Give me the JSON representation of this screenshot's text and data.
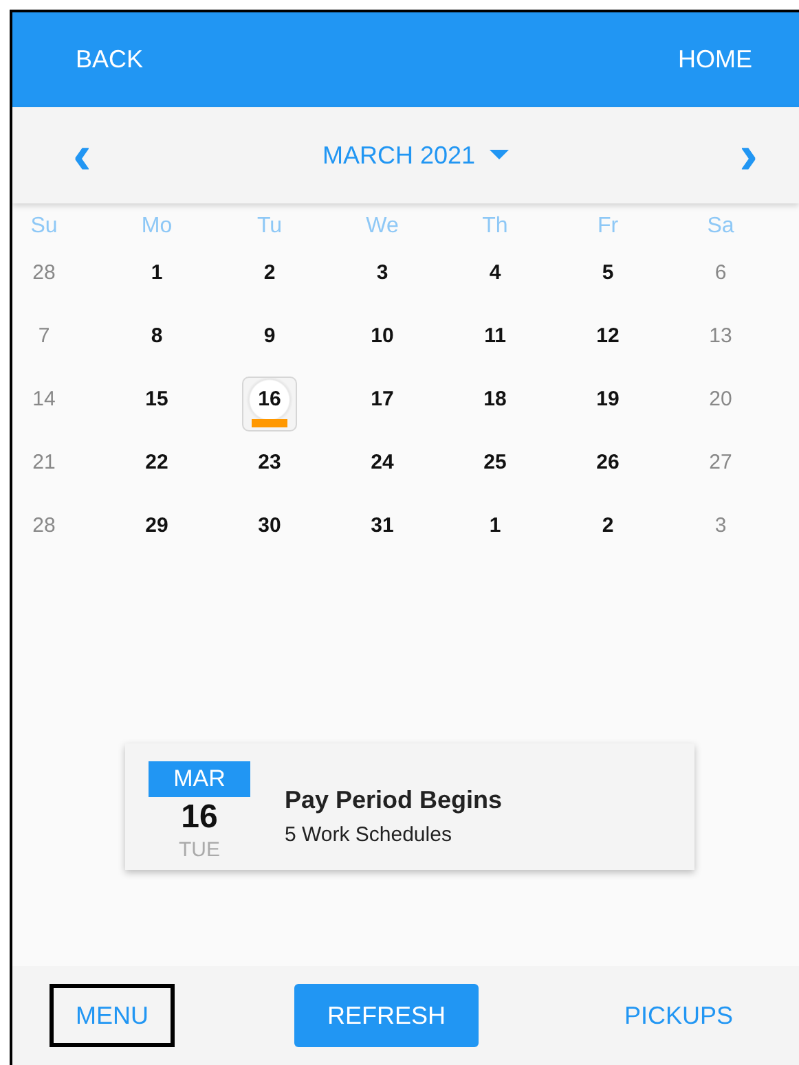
{
  "header": {
    "back": "BACK",
    "home": "HOME"
  },
  "month_nav": {
    "prev": "‹",
    "title": "MARCH 2021",
    "next": "›"
  },
  "weekdays": [
    "Su",
    "Mo",
    "Tu",
    "We",
    "Th",
    "Fr",
    "Sa"
  ],
  "weeks": [
    [
      {
        "label": "28",
        "muted": true,
        "selected": false,
        "marker": false
      },
      {
        "label": "1",
        "muted": false,
        "selected": false,
        "marker": false
      },
      {
        "label": "2",
        "muted": false,
        "selected": false,
        "marker": false
      },
      {
        "label": "3",
        "muted": false,
        "selected": false,
        "marker": false
      },
      {
        "label": "4",
        "muted": false,
        "selected": false,
        "marker": false
      },
      {
        "label": "5",
        "muted": false,
        "selected": false,
        "marker": false
      },
      {
        "label": "6",
        "muted": true,
        "selected": false,
        "marker": false
      }
    ],
    [
      {
        "label": "7",
        "muted": true,
        "selected": false,
        "marker": false
      },
      {
        "label": "8",
        "muted": false,
        "selected": false,
        "marker": false
      },
      {
        "label": "9",
        "muted": false,
        "selected": false,
        "marker": false
      },
      {
        "label": "10",
        "muted": false,
        "selected": false,
        "marker": false
      },
      {
        "label": "11",
        "muted": false,
        "selected": false,
        "marker": false
      },
      {
        "label": "12",
        "muted": false,
        "selected": false,
        "marker": false
      },
      {
        "label": "13",
        "muted": true,
        "selected": false,
        "marker": false
      }
    ],
    [
      {
        "label": "14",
        "muted": true,
        "selected": false,
        "marker": false
      },
      {
        "label": "15",
        "muted": false,
        "selected": false,
        "marker": false
      },
      {
        "label": "16",
        "muted": false,
        "selected": true,
        "marker": true
      },
      {
        "label": "17",
        "muted": false,
        "selected": false,
        "marker": false
      },
      {
        "label": "18",
        "muted": false,
        "selected": false,
        "marker": false
      },
      {
        "label": "19",
        "muted": false,
        "selected": false,
        "marker": false
      },
      {
        "label": "20",
        "muted": true,
        "selected": false,
        "marker": false
      }
    ],
    [
      {
        "label": "21",
        "muted": true,
        "selected": false,
        "marker": false
      },
      {
        "label": "22",
        "muted": false,
        "selected": false,
        "marker": false
      },
      {
        "label": "23",
        "muted": false,
        "selected": false,
        "marker": false
      },
      {
        "label": "24",
        "muted": false,
        "selected": false,
        "marker": false
      },
      {
        "label": "25",
        "muted": false,
        "selected": false,
        "marker": false
      },
      {
        "label": "26",
        "muted": false,
        "selected": false,
        "marker": false
      },
      {
        "label": "27",
        "muted": true,
        "selected": false,
        "marker": false
      }
    ],
    [
      {
        "label": "28",
        "muted": true,
        "selected": false,
        "marker": false
      },
      {
        "label": "29",
        "muted": false,
        "selected": false,
        "marker": false
      },
      {
        "label": "30",
        "muted": false,
        "selected": false,
        "marker": false
      },
      {
        "label": "31",
        "muted": false,
        "selected": false,
        "marker": false
      },
      {
        "label": "1",
        "muted": false,
        "selected": false,
        "marker": false
      },
      {
        "label": "2",
        "muted": false,
        "selected": false,
        "marker": false
      },
      {
        "label": "3",
        "muted": true,
        "selected": false,
        "marker": false
      }
    ]
  ],
  "event": {
    "month": "MAR",
    "day": "16",
    "weekday": "TUE",
    "title": "Pay Period Begins",
    "subtitle": "5 Work Schedules"
  },
  "footer": [
    {
      "label": "MENU",
      "kind": "text",
      "focused": true
    },
    {
      "label": "REFRESH",
      "kind": "filled",
      "focused": false
    },
    {
      "label": "PICKUPS",
      "kind": "text",
      "focused": false
    }
  ]
}
